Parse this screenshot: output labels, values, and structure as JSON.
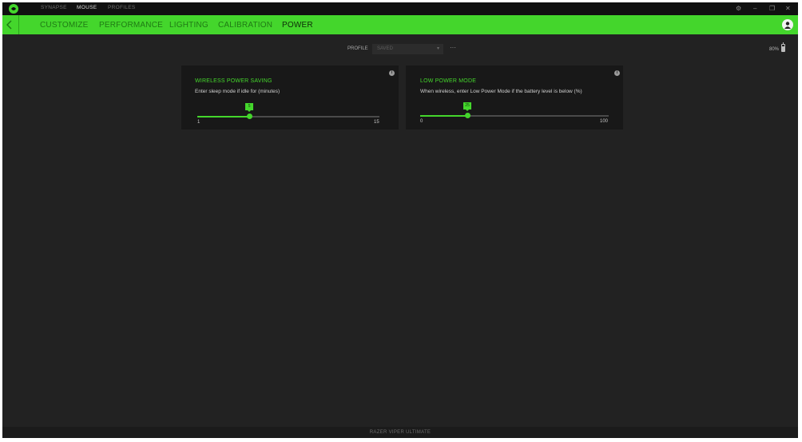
{
  "titlebar": {
    "tabs": [
      {
        "label": "SYNAPSE",
        "active": false
      },
      {
        "label": "MOUSE",
        "active": true
      },
      {
        "label": "PROFILES",
        "active": false
      }
    ],
    "controls": {
      "settings": "⚙",
      "minimize": "–",
      "restore": "❐",
      "close": "✕"
    }
  },
  "navbar": {
    "tabs": [
      {
        "label": "CUSTOMIZE",
        "active": false
      },
      {
        "label": "PERFORMANCE",
        "active": false
      },
      {
        "label": "LIGHTING",
        "active": false
      },
      {
        "label": "CALIBRATION",
        "active": false
      },
      {
        "label": "POWER",
        "active": true
      }
    ]
  },
  "profile": {
    "label": "PROFILE",
    "value": "SAVED",
    "more": "···"
  },
  "battery": {
    "percent_text": "80%",
    "level": 0.8
  },
  "cards": [
    {
      "title": "WIRELESS POWER SAVING",
      "description": "Enter sleep mode if idle for (minutes)",
      "slider": {
        "min": 1,
        "max": 15,
        "value": 5,
        "min_label": "1",
        "max_label": "15",
        "value_label": "5"
      }
    },
    {
      "title": "LOW POWER MODE",
      "description": "When wireless, enter Low Power Mode if the battery level is below (%)",
      "slider": {
        "min": 0,
        "max": 100,
        "value": 25,
        "min_label": "0",
        "max_label": "100",
        "value_label": "25"
      }
    }
  ],
  "footer": {
    "device_name": "RAZER VIPER ULTIMATE"
  },
  "colors": {
    "accent": "#44d62c",
    "background": "#222222",
    "card": "#181818"
  }
}
